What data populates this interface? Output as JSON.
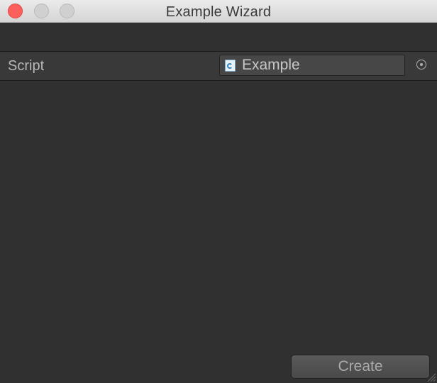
{
  "window": {
    "title": "Example Wizard"
  },
  "property": {
    "label": "Script",
    "value": "Example",
    "value_icon": "csharp-script-icon",
    "picker_icon": "object-picker-icon"
  },
  "actions": {
    "create_label": "Create"
  },
  "colors": {
    "background": "#303030",
    "titlebar": "#dcdcdc",
    "close_button": "#fc605c",
    "row_background": "#393939"
  }
}
